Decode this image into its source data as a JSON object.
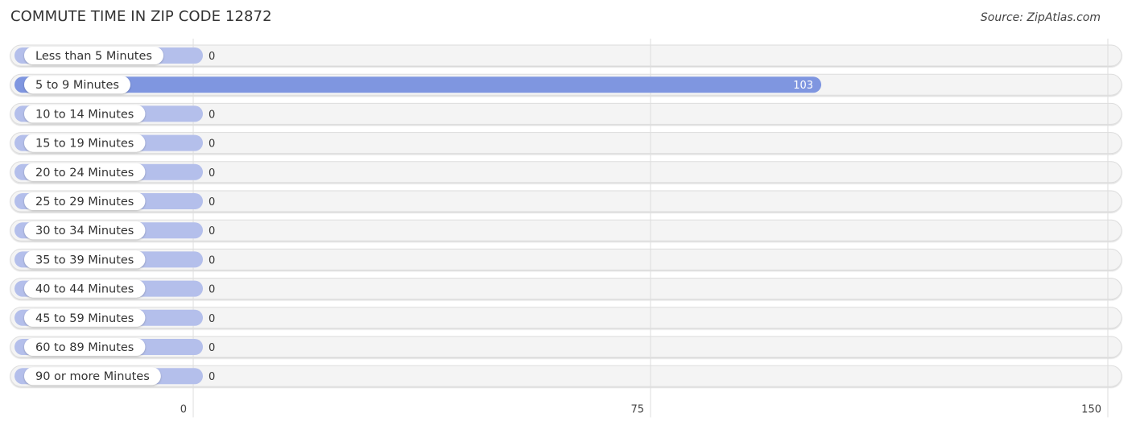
{
  "header": {
    "title": "COMMUTE TIME IN ZIP CODE 12872",
    "source": "Source: ZipAtlas.com"
  },
  "colors": {
    "bar_highlight": "#7f96e0",
    "bar_default": "#b4bfeb",
    "track": "#f4f4f4",
    "track_border": "#dddddd",
    "grid": "#dddddd",
    "label_pill": "#ffffff"
  },
  "chart_data": {
    "type": "bar",
    "orientation": "horizontal",
    "title": "COMMUTE TIME IN ZIP CODE 12872",
    "xlabel": "",
    "ylabel": "",
    "categories": [
      "Less than 5 Minutes",
      "5 to 9 Minutes",
      "10 to 14 Minutes",
      "15 to 19 Minutes",
      "20 to 24 Minutes",
      "25 to 29 Minutes",
      "30 to 34 Minutes",
      "35 to 39 Minutes",
      "40 to 44 Minutes",
      "45 to 59 Minutes",
      "60 to 89 Minutes",
      "90 or more Minutes"
    ],
    "values": [
      0,
      103,
      0,
      0,
      0,
      0,
      0,
      0,
      0,
      0,
      0,
      0
    ],
    "xlim": [
      0,
      150
    ],
    "xticks": [
      0,
      75,
      150
    ],
    "xtick_labels": [
      "0",
      "75",
      "150"
    ],
    "grid": true,
    "legend": "none"
  }
}
